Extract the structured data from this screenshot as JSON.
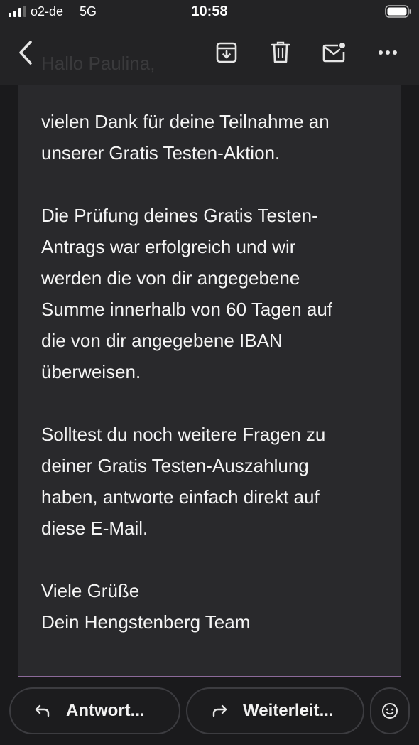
{
  "status_bar": {
    "carrier": "o2-de",
    "network": "5G",
    "time": "10:58"
  },
  "toolbar": {
    "ghost_greeting": "Hallo Paulina,",
    "icons": [
      "back-icon",
      "archive-icon",
      "trash-icon",
      "mark-unread-icon",
      "more-icon"
    ]
  },
  "message": {
    "paragraphs": [
      "vielen Dank für deine Teilnahme an\nunserer Gratis Testen-Aktion.",
      "Die Prüfung deines Gratis Testen-\nAntrags war erfolgreich und wir\nwerden die von dir angegebene\nSumme innerhalb von 60 Tagen auf\ndie von dir angegebene IBAN\nüberweisen.",
      "Solltest du noch weitere Fragen zu\ndeiner Gratis Testen-Auszahlung\nhaben, antworte einfach direkt auf\ndiese E-Mail."
    ],
    "signature": "Viele Grüße\nDein Hengstenberg Team"
  },
  "bottom_bar": {
    "reply_label": "Antwort...",
    "forward_label": "Weiterleit..."
  },
  "colors": {
    "background": "#1a1a1c",
    "message_bg": "#29292c",
    "accent_line": "#8c6a9a"
  }
}
